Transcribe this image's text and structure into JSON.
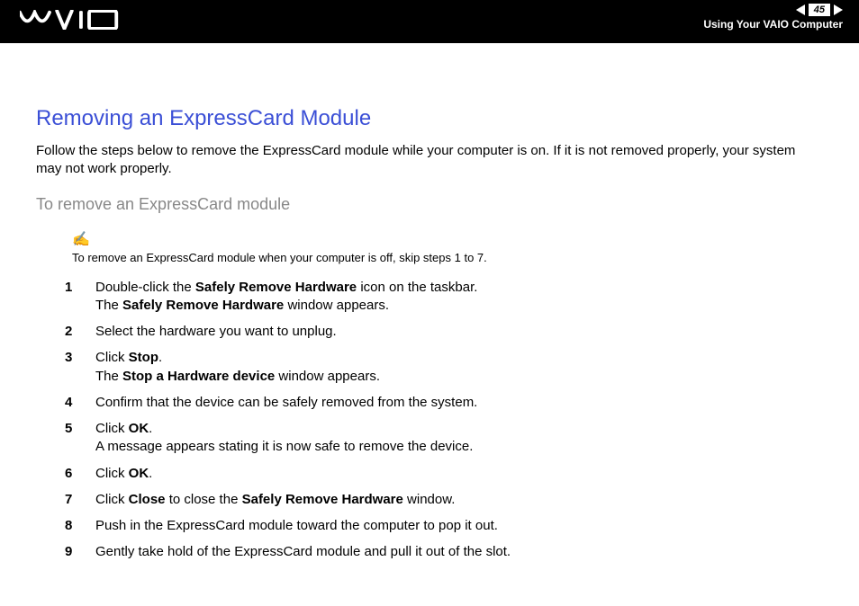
{
  "header": {
    "page_number": "45",
    "section": "Using Your VAIO Computer"
  },
  "content": {
    "title": "Removing an ExpressCard Module",
    "intro": "Follow the steps below to remove the ExpressCard module while your computer is on. If it is not removed properly, your system may not work properly.",
    "subtitle": "To remove an ExpressCard module",
    "note": "To remove an ExpressCard module when your computer is off, skip steps 1 to 7.",
    "steps": [
      {
        "num": "1",
        "pre": "Double-click the ",
        "b1": "Safely Remove Hardware",
        "mid": " icon on the taskbar.",
        "line2_pre": "The ",
        "line2_b": "Safely Remove Hardware",
        "line2_post": " window appears."
      },
      {
        "num": "2",
        "pre": "Select the hardware you want to unplug."
      },
      {
        "num": "3",
        "pre": "Click ",
        "b1": "Stop",
        "mid": ".",
        "line2_pre": "The ",
        "line2_b": "Stop a Hardware device",
        "line2_post": " window appears."
      },
      {
        "num": "4",
        "pre": "Confirm that the device can be safely removed from the system."
      },
      {
        "num": "5",
        "pre": "Click ",
        "b1": "OK",
        "mid": ".",
        "line2_pre": "A message appears stating it is now safe to remove the device."
      },
      {
        "num": "6",
        "pre": "Click ",
        "b1": "OK",
        "mid": "."
      },
      {
        "num": "7",
        "pre": "Click ",
        "b1": "Close",
        "mid": " to close the ",
        "b2": "Safely Remove Hardware",
        "post": " window."
      },
      {
        "num": "8",
        "pre": "Push in the ExpressCard module toward the computer to pop it out."
      },
      {
        "num": "9",
        "pre": "Gently take hold of the ExpressCard module and pull it out of the slot."
      }
    ]
  }
}
